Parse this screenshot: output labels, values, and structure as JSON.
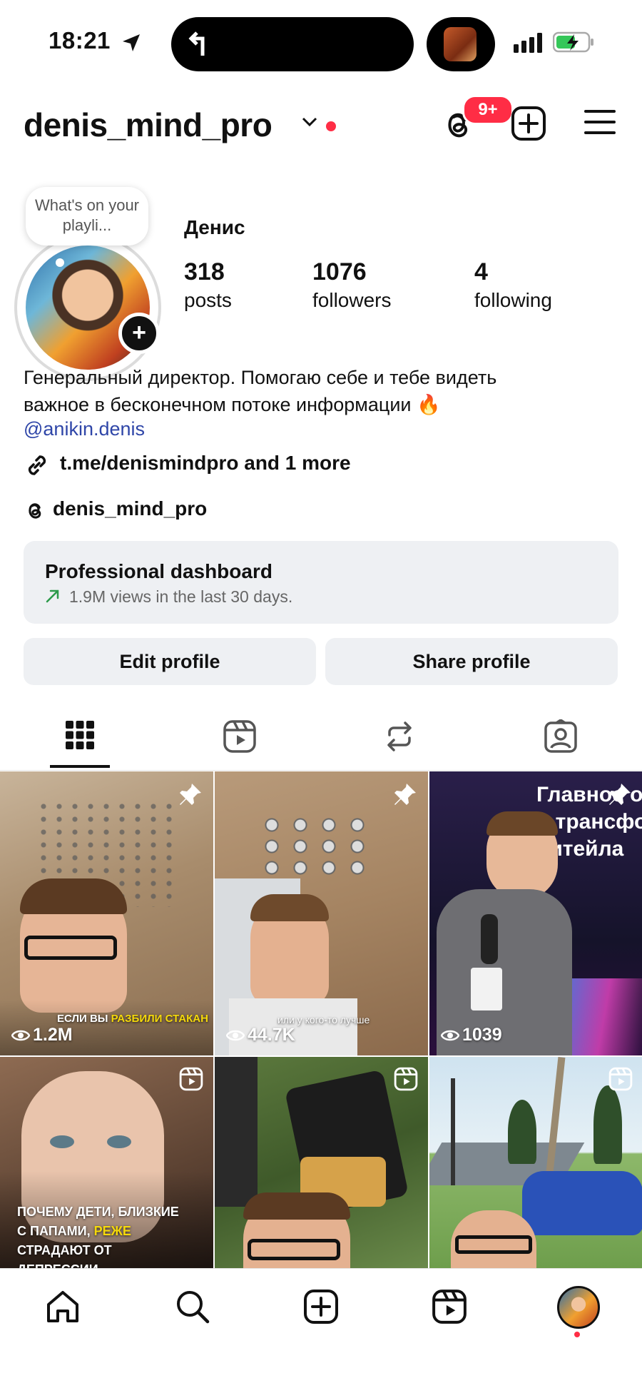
{
  "status_bar": {
    "time": "18:21"
  },
  "header": {
    "username": "denis_mind_pro",
    "threads_badge": "9+"
  },
  "profile": {
    "note": "What's on your playli...",
    "display_name": "Денис",
    "stats": [
      {
        "value": "318",
        "label": "posts"
      },
      {
        "value": "1076",
        "label": "followers"
      },
      {
        "value": "4",
        "label": "following"
      }
    ],
    "bio_line1": "Генеральный директор. Помогаю себе и тебе видеть",
    "bio_line2": "важное в бесконечном потоке информации 🔥",
    "mention": "@anikin.denis",
    "link": "t.me/denismindpro and 1 more",
    "threads_handle": "denis_mind_pro"
  },
  "dashboard": {
    "title": "Professional dashboard",
    "subtitle": "1.9M views in the last 30 days."
  },
  "buttons": {
    "edit": "Edit profile",
    "share": "Share profile"
  },
  "grid": [
    {
      "views": "1.2M",
      "caption_pre": "ЕСЛИ ВЫ ",
      "caption_hl": "РАЗБИЛИ СТАКАН",
      "pinned": true
    },
    {
      "views": "44.7K",
      "caption": "или у кого-то лучше",
      "pinned": true
    },
    {
      "views": "1039",
      "slide_text": "Главное о\nо трансфо\nритейла",
      "pinned": true
    },
    {
      "caption_line1": "ПОЧЕМУ ДЕТИ, БЛИЗКИЕ",
      "caption_line2_pre": "С ПАПАМИ, ",
      "caption_line2_hl": "РЕЖЕ",
      "caption_line3": "СТРАДАЮТ ОТ",
      "caption_line4": "ДЕПРЕССИИ"
    },
    {},
    {}
  ],
  "colors": {
    "accent_red": "#ff2d45",
    "link_blue": "#2f46a8",
    "caption_yellow": "#f5d90a"
  }
}
